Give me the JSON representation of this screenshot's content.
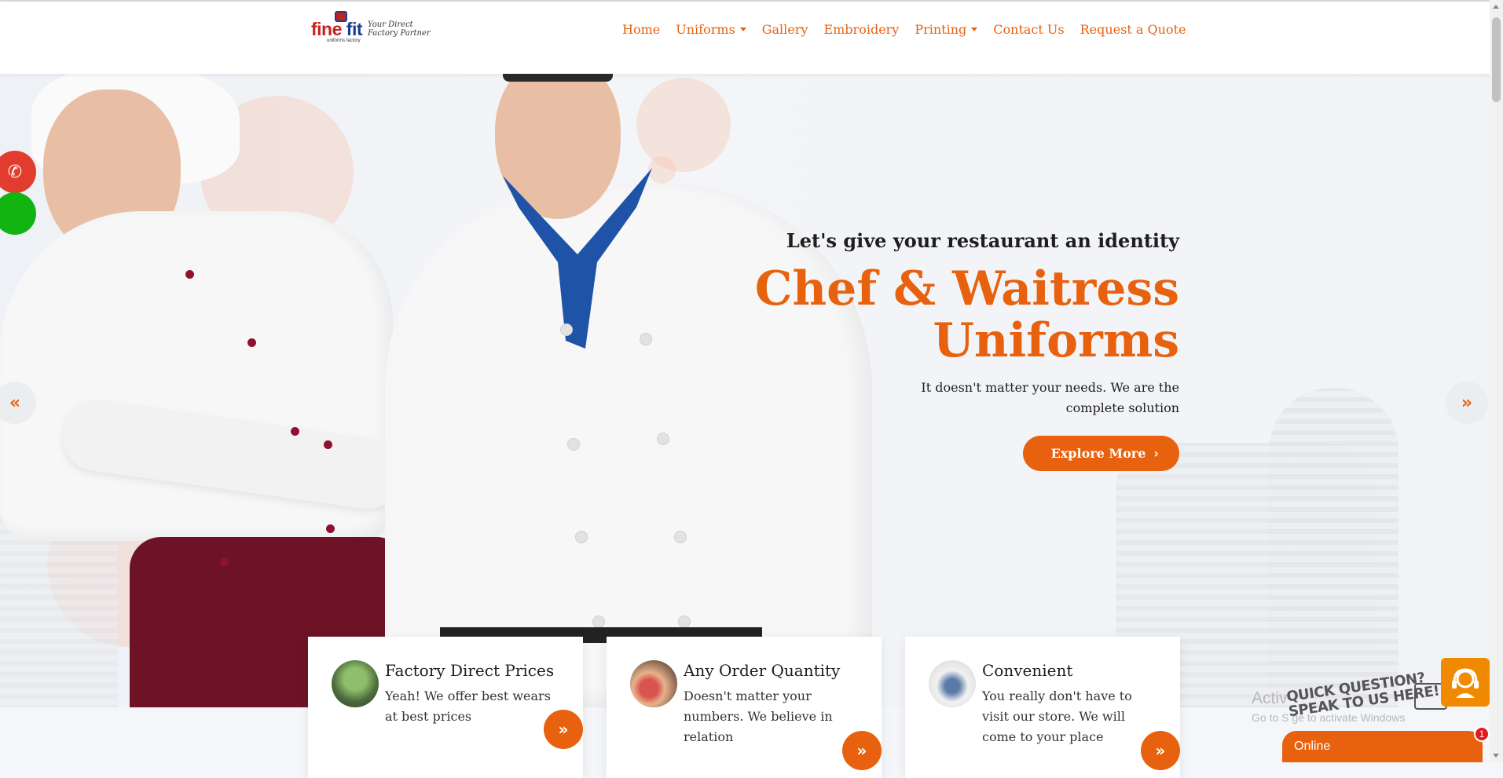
{
  "brand": {
    "logo_word_a": "fine",
    "logo_word_b": "fit",
    "logo_sub": "uniforms factory",
    "logo_tagline": "Your Direct Factory Partner"
  },
  "nav": {
    "items": [
      {
        "label": "Home",
        "dropdown": false
      },
      {
        "label": "Uniforms",
        "dropdown": true
      },
      {
        "label": "Gallery",
        "dropdown": false
      },
      {
        "label": "Embroidery",
        "dropdown": false
      },
      {
        "label": "Printing",
        "dropdown": true
      },
      {
        "label": "Contact Us",
        "dropdown": false
      },
      {
        "label": "Request a Quote",
        "dropdown": false
      }
    ]
  },
  "hero": {
    "kicker": "Let's give your restaurant an identity",
    "headline": "Chef & Waitress Uniforms",
    "description": "It doesn't matter your needs. We are the complete solution",
    "cta_label": "Explore More",
    "prev_icon": "«",
    "next_icon": "»"
  },
  "features": [
    {
      "title": "Factory Direct Prices",
      "text": "Yeah! We offer best wears at best prices",
      "icon": "money-plant-icon"
    },
    {
      "title": "Any Order Quantity",
      "text": "Doesn't matter your numbers. We believe in relation",
      "icon": "shopping-bags-icon"
    },
    {
      "title": "Convenient",
      "text": "You really don't have to visit our store. We will come to your place",
      "icon": "meeting-icon"
    }
  ],
  "chat": {
    "quick_line1": "QUICK QUESTION?",
    "quick_line2": "SPEAK TO US HERE!",
    "status": "Online",
    "unread": "1"
  },
  "watermark": {
    "line1": "Activ",
    "line2": "Go to S",
    "line2_tail": "ge to activate Windows"
  },
  "colors": {
    "accent": "#e8610e",
    "phone": "#e23c2f",
    "whatsapp": "#12b412",
    "agent": "#f08a00"
  }
}
